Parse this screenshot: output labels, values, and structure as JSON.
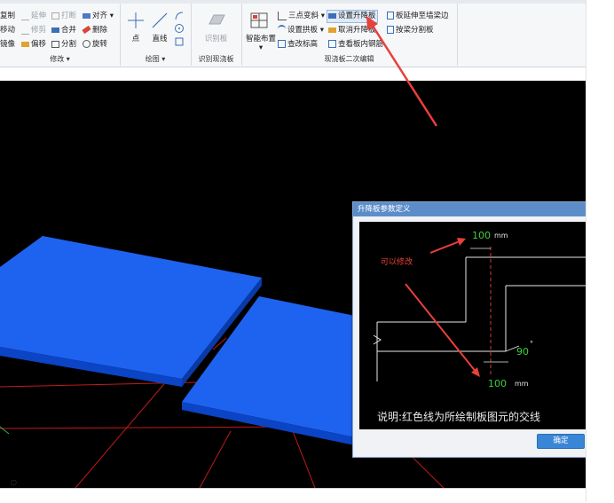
{
  "ribbon": {
    "modify": {
      "label": "修改",
      "items": [
        "复制",
        "延伸",
        "打断",
        "对齐",
        "移动",
        "修剪",
        "合并",
        "删除",
        "镜像",
        "偏移",
        "分割",
        "旋转"
      ]
    },
    "draw": {
      "label": "绘图",
      "point": "点",
      "line": "直线"
    },
    "identify": {
      "label": "识别现浇板",
      "button": "识别板"
    },
    "secondary_edit": {
      "label": "现浇板二次编辑",
      "smart_layout": "智能布置",
      "items": [
        "三点变斜",
        "设置升降板",
        "板延伸至墙梁边",
        "设置拱板",
        "取消升降板",
        "按梁分割板",
        "查改标高",
        "查看板内钢筋"
      ]
    }
  },
  "dialog": {
    "title": "升降板参数定义",
    "top_value": "100",
    "top_unit": "mm",
    "bottom_value": "100",
    "bottom_unit": "mm",
    "angle_value": "90",
    "angle_unit": "°",
    "annotation": "可以修改",
    "description": "说明:红色线为所绘制板图元的交线",
    "ok_button": "确定"
  },
  "colors": {
    "slab": "#1560e8",
    "slab_top": "#1e63f0",
    "slab_side": "#0b44c4",
    "grid": "#c21a1a",
    "arrow": "#e8403a",
    "value_green": "#3ad23a"
  }
}
